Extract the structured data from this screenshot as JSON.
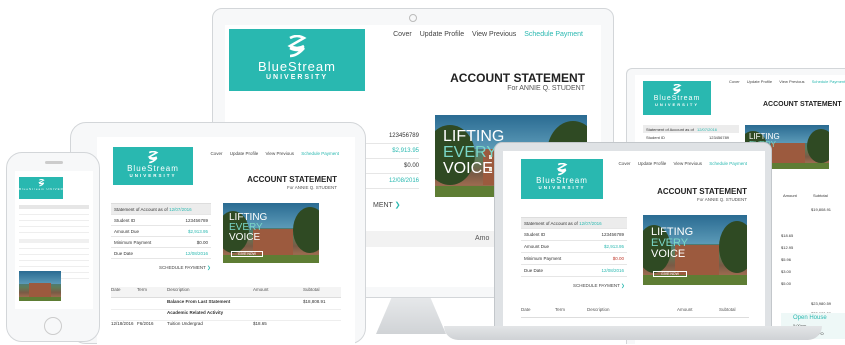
{
  "brand": {
    "name_line1": "BlueStream",
    "name_line2": "UNIVERSITY",
    "teal": "#29b8b0"
  },
  "nav": {
    "cover": "Cover",
    "update_profile": "Update Profile",
    "view_previous": "View Previous",
    "schedule_payment": "Schedule Payment"
  },
  "statement": {
    "title": "ACCOUNT STATEMENT",
    "subtitle": "For ANNIE Q. STUDENT",
    "summary_header": "Statement of Account as of",
    "summary_date": "12/07/2016",
    "rows": [
      {
        "label": "Student ID",
        "value": "123456789"
      },
      {
        "label": "Amount Due",
        "value": "$2,913.95"
      },
      {
        "label": "Minimum Payment",
        "value": "$0.00"
      },
      {
        "label": "Due Date",
        "value": "12/08/2016"
      }
    ],
    "schedule_link": "SCHEDULE PAYMENT",
    "table_headers": [
      "Date",
      "Term",
      "Description",
      "Amount",
      "Subtotal"
    ],
    "table_rows": [
      {
        "date": "",
        "term": "",
        "description": "Balance From Last Statement",
        "amount": "",
        "subtotal": "$18,808.91"
      },
      {
        "date": "",
        "term": "",
        "description": "Academic Related Activity",
        "amount": "",
        "subtotal": ""
      },
      {
        "date": "12/18/2016",
        "term": "F6/2016",
        "description": "Tuition Undergrad",
        "amount": "$18.65",
        "subtotal": ""
      }
    ],
    "monitor_partial": {
      "student_id": "123456789",
      "amount_due": "$2,913.95",
      "min_payment": "$0.00",
      "due_date": "12/08/2016",
      "schedule": "MENT",
      "col_description": "ription",
      "col_amount": "Amo"
    }
  },
  "promo": {
    "line1": "LIFTING",
    "line2": "EVERY",
    "line3": "VOICE",
    "button": "GIVE NOW"
  },
  "right_partial": {
    "col_amount": "Amount",
    "col_subtotal": "Subtotal",
    "subtotal_value": "$19,808.91",
    "values": [
      "$18.65",
      "$12.95",
      "$5.96",
      "$3.00",
      "$5.00"
    ],
    "total1": "$23,980.59",
    "total2": "$23,980.59",
    "event": "Open House",
    "event_time": "5:00pm",
    "more": "MORE INFO"
  },
  "phone": {
    "logo_line": "BlueStream UNIVERSITY"
  }
}
